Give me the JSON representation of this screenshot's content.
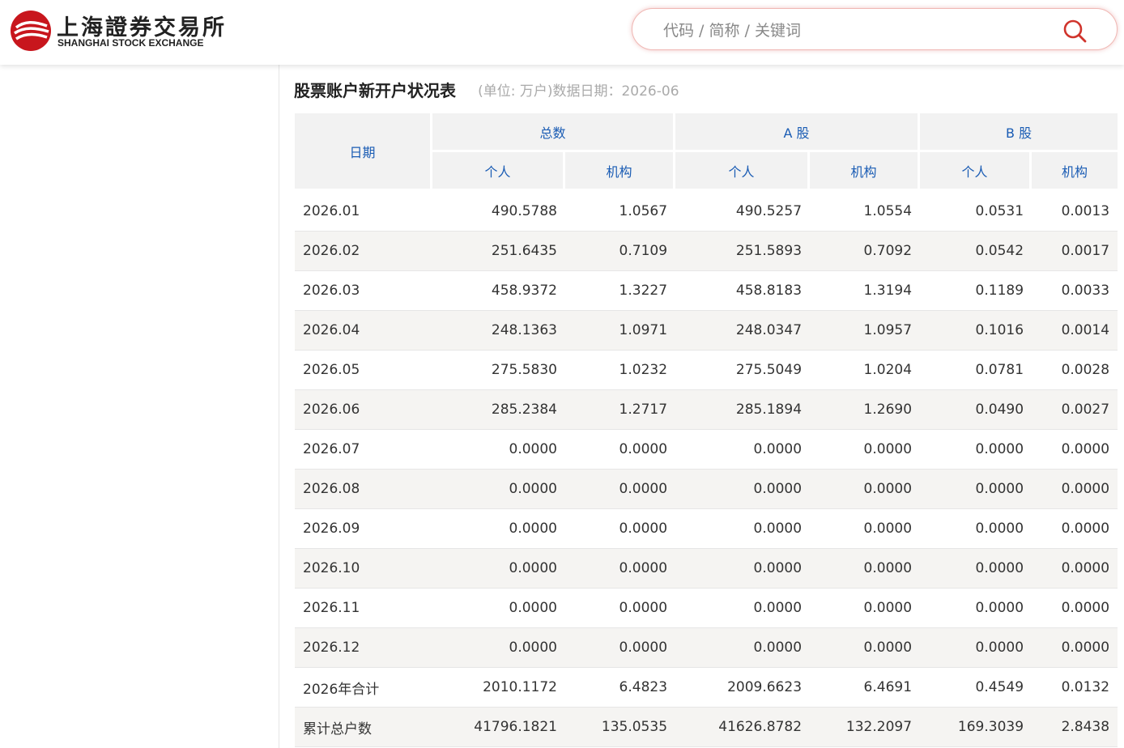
{
  "header": {
    "logo_cn": "上海證券交易所",
    "logo_en": "SHANGHAI STOCK EXCHANGE",
    "logo_color": "#c8161d",
    "search_placeholder": "代码 / 简称 / 关键词",
    "search_icon": "search-icon"
  },
  "report": {
    "title": "股票账户新开户状况表",
    "subtitle": "(单位: 万户)数据日期：2026-06"
  },
  "table": {
    "headers": {
      "date": "日期",
      "total": "总数",
      "a_share": "A 股",
      "b_share": "B 股",
      "individual": "个人",
      "institution": "机构"
    },
    "rows": [
      [
        "2026.01",
        "490.5788",
        "1.0567",
        "490.5257",
        "1.0554",
        "0.0531",
        "0.0013"
      ],
      [
        "2026.02",
        "251.6435",
        "0.7109",
        "251.5893",
        "0.7092",
        "0.0542",
        "0.0017"
      ],
      [
        "2026.03",
        "458.9372",
        "1.3227",
        "458.8183",
        "1.3194",
        "0.1189",
        "0.0033"
      ],
      [
        "2026.04",
        "248.1363",
        "1.0971",
        "248.0347",
        "1.0957",
        "0.1016",
        "0.0014"
      ],
      [
        "2026.05",
        "275.5830",
        "1.0232",
        "275.5049",
        "1.0204",
        "0.0781",
        "0.0028"
      ],
      [
        "2026.06",
        "285.2384",
        "1.2717",
        "285.1894",
        "1.2690",
        "0.0490",
        "0.0027"
      ],
      [
        "2026.07",
        "0.0000",
        "0.0000",
        "0.0000",
        "0.0000",
        "0.0000",
        "0.0000"
      ],
      [
        "2026.08",
        "0.0000",
        "0.0000",
        "0.0000",
        "0.0000",
        "0.0000",
        "0.0000"
      ],
      [
        "2026.09",
        "0.0000",
        "0.0000",
        "0.0000",
        "0.0000",
        "0.0000",
        "0.0000"
      ],
      [
        "2026.10",
        "0.0000",
        "0.0000",
        "0.0000",
        "0.0000",
        "0.0000",
        "0.0000"
      ],
      [
        "2026.11",
        "0.0000",
        "0.0000",
        "0.0000",
        "0.0000",
        "0.0000",
        "0.0000"
      ],
      [
        "2026.12",
        "0.0000",
        "0.0000",
        "0.0000",
        "0.0000",
        "0.0000",
        "0.0000"
      ],
      [
        "2026年合计",
        "2010.1172",
        "6.4823",
        "2009.6623",
        "6.4691",
        "0.4549",
        "0.0132"
      ],
      [
        "累计总户数",
        "41796.1821",
        "135.0535",
        "41626.8782",
        "132.2097",
        "169.3039",
        "2.8438"
      ]
    ]
  },
  "colors": {
    "header_text": "#1a5cb4",
    "header_bg": "#f2f2f2",
    "stripe_bg": "#f5f4f2",
    "accent_red": "#c8161d"
  }
}
